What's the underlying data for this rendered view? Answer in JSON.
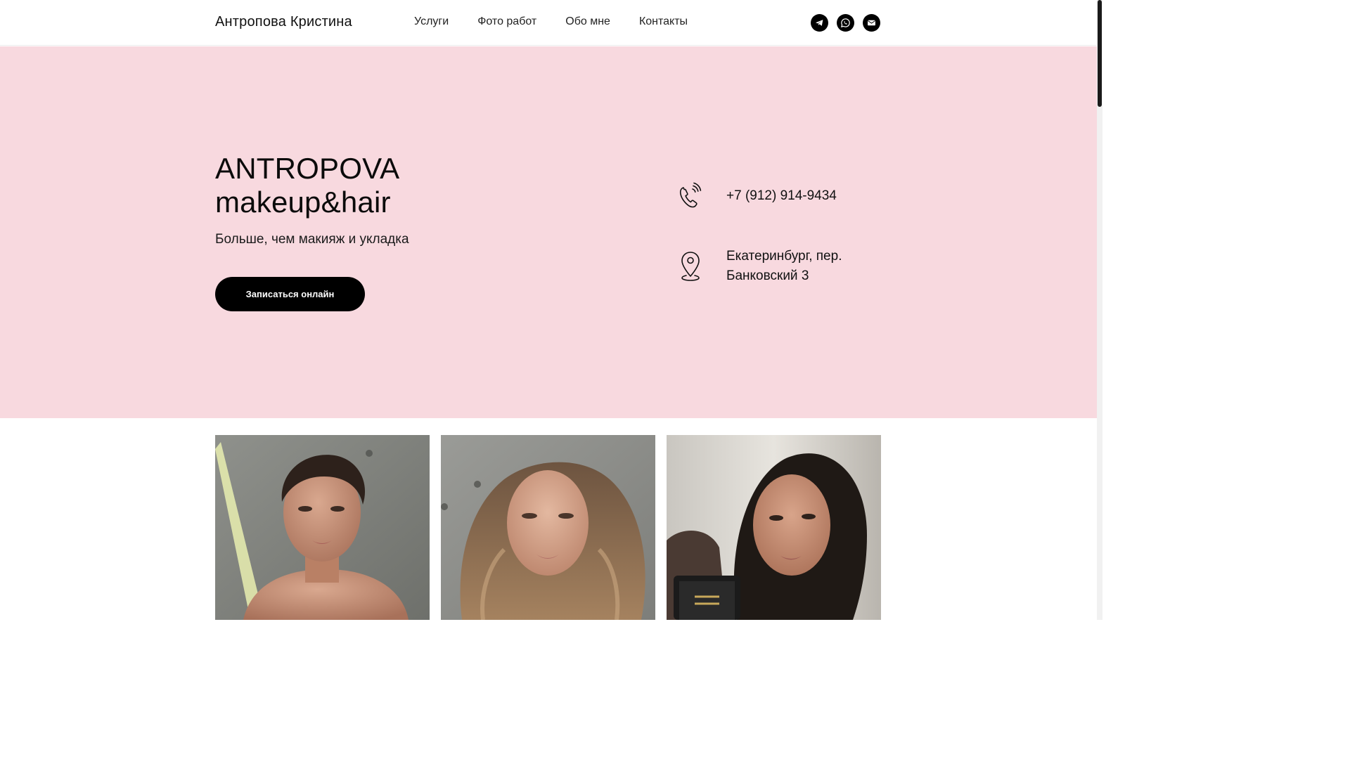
{
  "header": {
    "brand": "Антропова Кристина",
    "nav": [
      {
        "label": "Услуги"
      },
      {
        "label": "Фото работ"
      },
      {
        "label": "Обо мне"
      },
      {
        "label": "Контакты"
      }
    ],
    "socials": [
      {
        "icon": "telegram-icon"
      },
      {
        "icon": "whatsapp-icon"
      },
      {
        "icon": "email-icon"
      }
    ]
  },
  "hero": {
    "title_line1": "ANTROPOVA",
    "title_line2": "makeup&hair",
    "subtitle": "Больше, чем макияж и укладка",
    "cta_label": "Записаться онлайн",
    "background": "#f8d9df",
    "phone": "+7 (912) 914-9434",
    "address_line1": "Екатеринбург, пер.",
    "address_line2": "Банковский 3"
  },
  "gallery": {
    "photos": [
      {
        "name": "portrait-updo"
      },
      {
        "name": "portrait-waves"
      },
      {
        "name": "portrait-dark-hair"
      }
    ]
  }
}
